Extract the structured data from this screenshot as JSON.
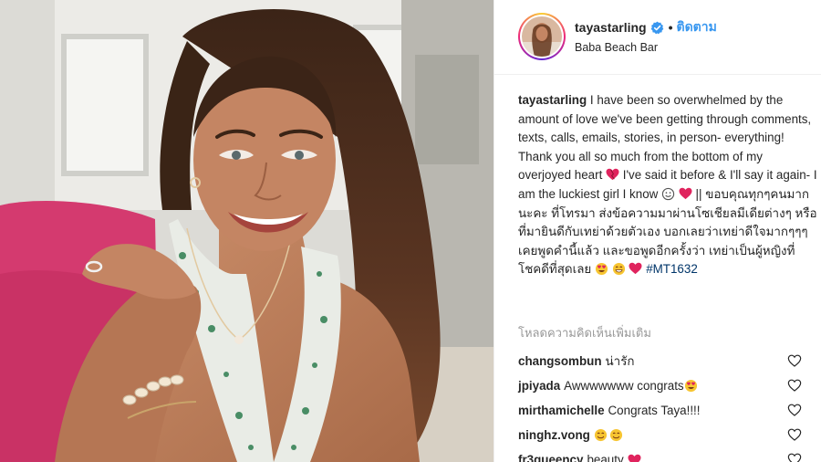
{
  "post": {
    "username": "tayastarling",
    "follow_label": "ติดตาม",
    "location": "Baba Beach Bar"
  },
  "caption": {
    "username": "tayastarling",
    "text_1": "I have been so overwhelmed by the amount of love we've been getting through comments, texts, calls, emails, stories, in person- everything! Thank you all so much from the bottom of my overjoyed heart",
    "text_2": "I've said it before & I'll say it again- I am the luckiest girl I know",
    "text_3": "||",
    "thai_text": "ขอบคุณทุกๆคนมากนะคะ ที่โทรมา ส่งข้อความมาผ่านโซเชียลมีเดียต่างๆ หรือที่มายินดีกับเทย่าด้วยตัวเอง บอกเลยว่าเทย่าดีใจมากๆๆๆ เคยพูดคำนี้แล้ว และขอพูดอีกครั้งว่า เทย่าเป็นผู้หญิงที่โชคดีที่สุดเลย",
    "hashtag": "#MT1632"
  },
  "load_more_label": "โหลดความคิดเห็นเพิ่มเติม",
  "comments": [
    {
      "username": "changsombun",
      "text": "น่ารัก"
    },
    {
      "username": "jpiyada",
      "text": "Awwwwwww congrats"
    },
    {
      "username": "mirthamichelle",
      "text": "Congrats Taya!!!!"
    },
    {
      "username": "ninghz.vong",
      "text": ""
    },
    {
      "username": "fr3queency",
      "text": "beauty"
    }
  ],
  "icons": {
    "verified": "verified-badge-icon",
    "like": "heart-outline-icon",
    "emoji_heart": "red-heart-emoji-icon",
    "emoji_smile": "smiling-face-emoji-icon"
  },
  "colors": {
    "follow_blue": "#3897f0",
    "hashtag_blue": "#003569",
    "muted_gray": "#999999",
    "heart_red": "#e0245e"
  }
}
